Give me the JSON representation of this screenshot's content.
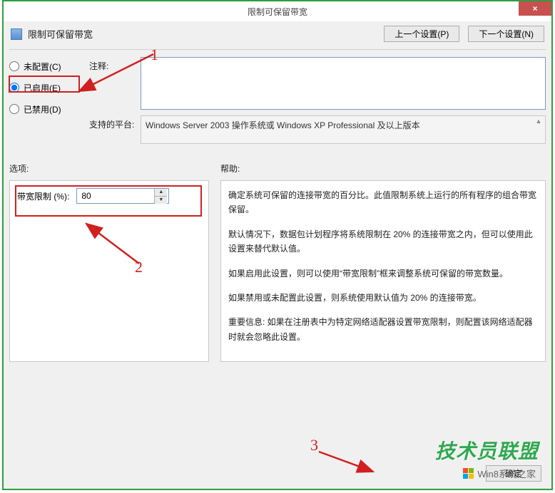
{
  "window": {
    "title": "限制可保留带宽",
    "close_glyph": "×"
  },
  "header": {
    "title": "限制可保留带宽",
    "prev_button": "上一个设置(P)",
    "next_button": "下一个设置(N)"
  },
  "radios": {
    "not_configured": "未配置(C)",
    "enabled": "已启用(E)",
    "disabled": "已禁用(D)",
    "selected": "enabled"
  },
  "form": {
    "comment_label": "注释:",
    "comment_value": "",
    "platform_label": "支持的平台:",
    "platform_value": "Windows Server 2003 操作系统或 Windows XP Professional 及以上版本"
  },
  "options": {
    "section_label": "选项:",
    "bandwidth_label": "带宽限制 (%):",
    "bandwidth_value": "80"
  },
  "help": {
    "section_label": "帮助:",
    "p1": "确定系统可保留的连接带宽的百分比。此值限制系统上运行的所有程序的组合带宽保留。",
    "p2": "默认情况下，数据包计划程序将系统限制在 20% 的连接带宽之内，但可以使用此设置来替代默认值。",
    "p3": "如果启用此设置，则可以使用“带宽限制”框来调整系统可保留的带宽数量。",
    "p4": "如果禁用或未配置此设置，则系统使用默认值为 20% 的连接带宽。",
    "p5": "重要信息: 如果在注册表中为特定网络适配器设置带宽限制，则配置该网络适配器时就会忽略此设置。"
  },
  "footer": {
    "ok": "确定"
  },
  "annotations": {
    "label1": "1",
    "label2": "2",
    "label3": "3"
  },
  "watermark": {
    "text1": "技术员联盟",
    "text2": "Win8系统之家"
  }
}
